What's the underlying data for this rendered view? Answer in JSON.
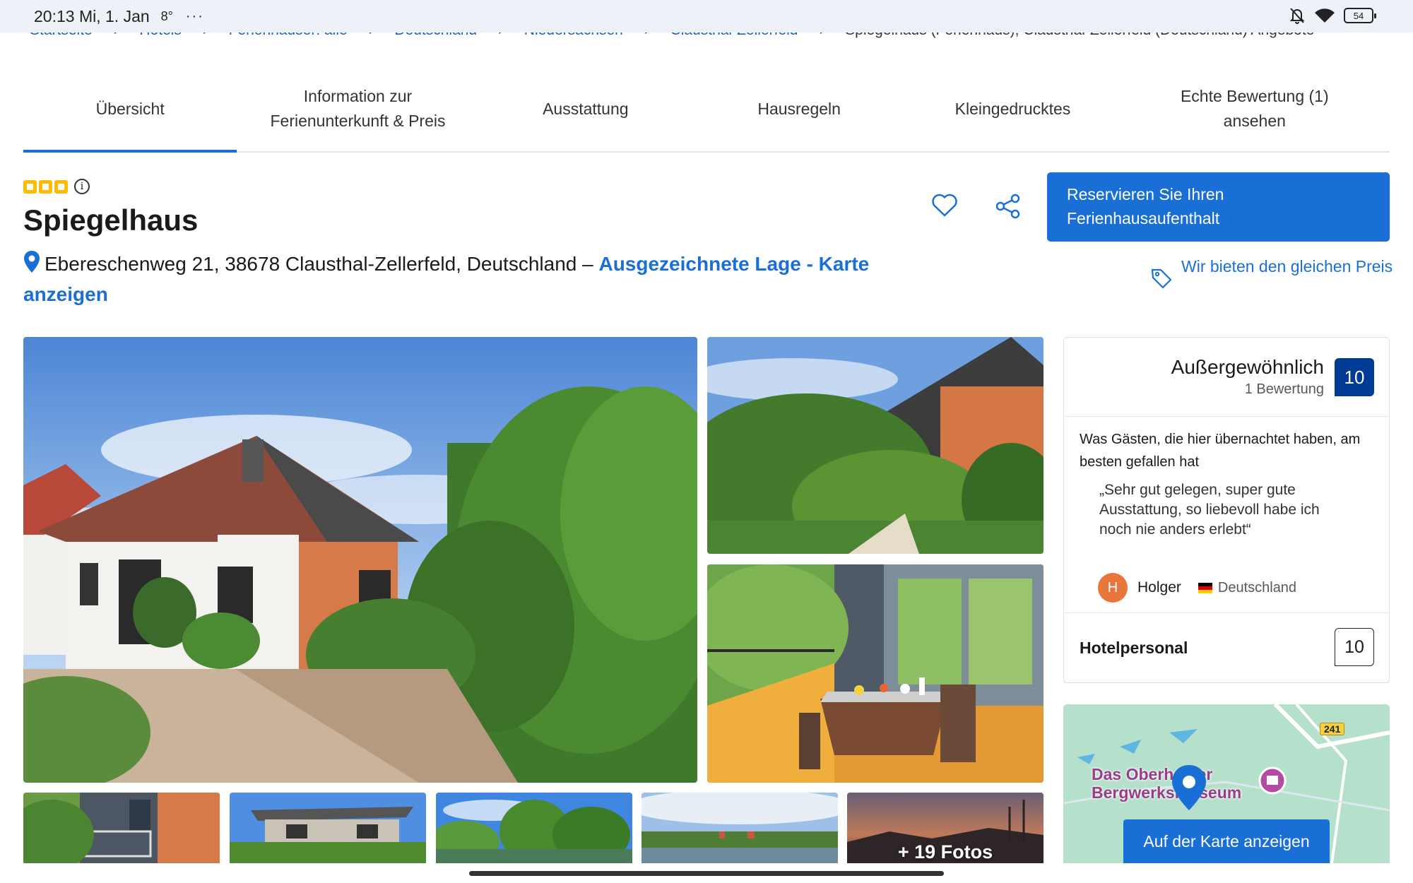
{
  "status_bar": {
    "time": "20:13 Mi, 1. Jan",
    "temperature": "8°",
    "more": "···",
    "battery": "54"
  },
  "breadcrumb": {
    "items": [
      "Startseite",
      "Hotels",
      "Ferienhäuser: alle",
      "Deutschland",
      "Niedersachsen",
      "Clausthal-Zellerfeld"
    ],
    "current": "Spiegelhaus (Ferienhaus), Clausthal-Zellerfeld (Deutschland) Angebote",
    "separator": "›"
  },
  "tabs": [
    {
      "label": "Übersicht",
      "active": true
    },
    {
      "label": "Information zur Ferienunterkunft & Preis",
      "active": false
    },
    {
      "label": "Ausstattung",
      "active": false
    },
    {
      "label": "Hausregeln",
      "active": false
    },
    {
      "label": "Kleingedrucktes",
      "active": false
    },
    {
      "label": "Echte Bewertung (1) ansehen",
      "active": false
    }
  ],
  "property": {
    "stars": 3,
    "name": "Spiegelhaus",
    "address": "Ebereschenweg 21, 38678 Clausthal-Zellerfeld, Deutschland –",
    "location_link": "Ausgezeichnete Lage - Karte anzeigen"
  },
  "actions": {
    "reserve_label": "Reservieren Sie Ihren Ferienhausaufenthalt",
    "price_match_label": "Wir bieten den gleichen Preis"
  },
  "gallery": {
    "more_photos_label": "+ 19 Fotos"
  },
  "review": {
    "rating_label": "Außergewöhnlich",
    "review_count": "1 Bewertung",
    "score": "10",
    "liked_heading": "Was Gästen, die hier übernachtet haben, am besten gefallen hat",
    "quote": "„Sehr gut gelegen, super gute Ausstattung, so liebevoll habe ich noch nie anders erlebt“",
    "author_initial": "H",
    "author_name": "Holger",
    "author_country": "Deutschland",
    "category_label": "Hotelpersonal",
    "category_score": "10"
  },
  "map": {
    "poi_label": "Das Oberharzer Bergwerksmuseum",
    "road_number": "241",
    "button_label": "Auf der Karte anzeigen"
  },
  "colors": {
    "primary_blue": "#1a6fd6",
    "score_navy": "#003b95",
    "star_yellow": "#febb02"
  }
}
